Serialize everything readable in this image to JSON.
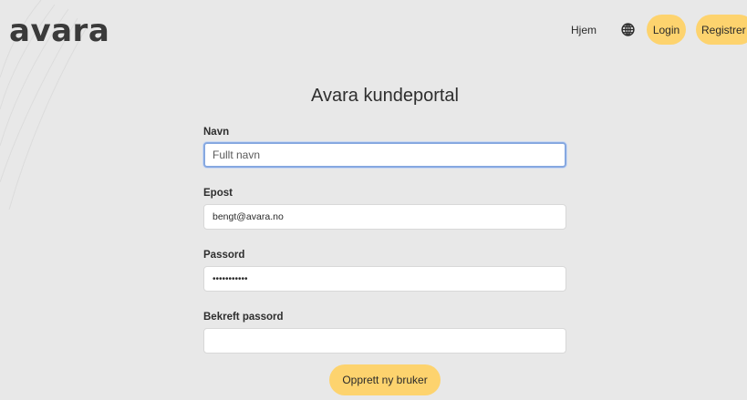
{
  "header": {
    "logo": "avara",
    "nav_home": "Hjem",
    "language_icon": "globe-icon",
    "login_label": "Login",
    "register_label": "Registrer"
  },
  "main": {
    "title": "Avara kundeportal",
    "form": {
      "name_label": "Navn",
      "name_placeholder": "Fullt navn",
      "name_value": "",
      "email_label": "Epost",
      "email_value": "bengt@avara.no",
      "password_label": "Passord",
      "password_value": "hunter12345",
      "confirm_label": "Bekreft passord",
      "confirm_value": "",
      "submit_label": "Opprett ny bruker"
    }
  },
  "colors": {
    "background": "#e8e8e8",
    "accent": "#fdd36e",
    "text": "#2e2e2e",
    "focus_border": "#86a8e0"
  }
}
